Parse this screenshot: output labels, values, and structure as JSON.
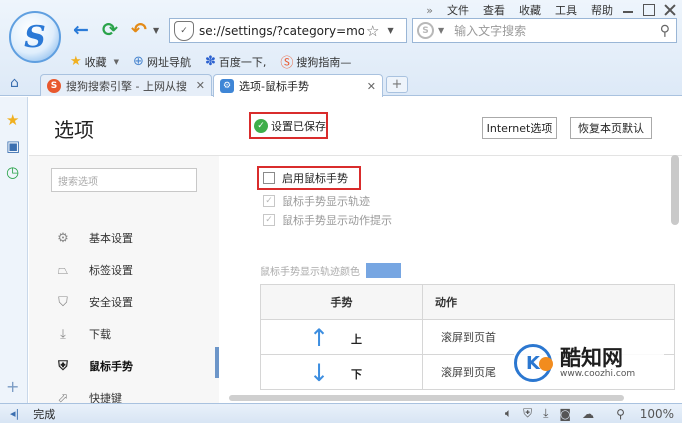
{
  "browser": {
    "logo_letter": "S",
    "menu": [
      "文件",
      "查看",
      "收藏",
      "工具",
      "帮助"
    ],
    "menu_chevron": "»",
    "address_url": "se://settings/?category=mo",
    "search_placeholder": "输入文字搜索",
    "bookmarks": [
      {
        "label": "收藏",
        "icon": "star-icon"
      },
      {
        "label": "网址导航",
        "icon": "globe-icon"
      },
      {
        "label": "百度一下,",
        "icon": "paw-icon"
      },
      {
        "label": "搜狗指南—",
        "icon": "sogou-s-icon"
      }
    ],
    "tabs": [
      {
        "label": "搜狗搜索引擎 - 上网从搜",
        "icon": "sogou-s-icon",
        "active": false
      },
      {
        "label": "选项-鼠标手势",
        "icon": "settings-icon",
        "active": true
      }
    ],
    "new_tab_symbol": "+"
  },
  "settings": {
    "title": "选项",
    "saved_status": "设置已保存",
    "buttons": {
      "internet": "Internet选项",
      "restore": "恢复本页默认"
    },
    "search_placeholder": "搜索选项",
    "sidebar": [
      {
        "label": "基本设置",
        "icon": "gear-icon",
        "active": false
      },
      {
        "label": "标签设置",
        "icon": "tab-icon",
        "active": false
      },
      {
        "label": "安全设置",
        "icon": "shield-icon",
        "active": false
      },
      {
        "label": "下载",
        "icon": "download-icon",
        "active": false
      },
      {
        "label": "鼠标手势",
        "icon": "mouse-gesture-icon",
        "active": true
      },
      {
        "label": "快捷键",
        "icon": "shortcut-icon",
        "active": false
      }
    ],
    "enable_gesture": {
      "label": "启用鼠标手势",
      "checked": false
    },
    "options": [
      {
        "label": "鼠标手势显示轨迹",
        "checked": true,
        "disabled": true
      },
      {
        "label": "鼠标手势显示动作提示",
        "checked": true,
        "disabled": true
      }
    ],
    "trail_color_label": "鼠标手势显示轨迹颜色",
    "trail_color": "#77a6e2",
    "gesture_table": {
      "headers": [
        "手势",
        "动作"
      ],
      "rows": [
        {
          "arrow": "↑",
          "direction": "上",
          "action": "滚屏到页首"
        },
        {
          "arrow": "↓",
          "direction": "下",
          "action": "滚屏到页尾"
        }
      ]
    }
  },
  "watermark": {
    "name": "酷知网",
    "url": "www.coozhi.com"
  },
  "status_bar": {
    "text": "完成",
    "zoom": "100%"
  },
  "colors": {
    "highlight_red": "#d92c2c",
    "accent_blue": "#3d8ee0",
    "active_bar": "#6d96c9"
  }
}
